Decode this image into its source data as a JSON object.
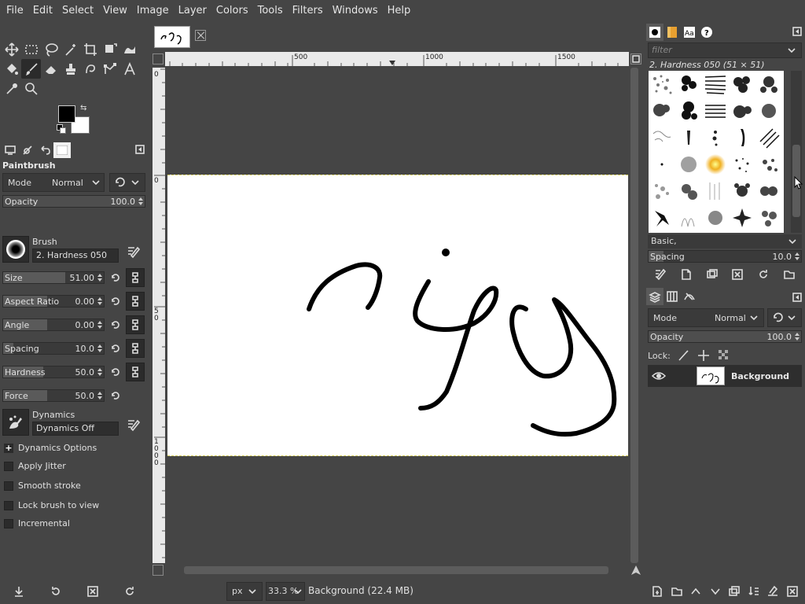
{
  "menubar": {
    "items": [
      "File",
      "Edit",
      "Select",
      "View",
      "Image",
      "Layer",
      "Colors",
      "Tools",
      "Filters",
      "Windows",
      "Help"
    ]
  },
  "tools": {
    "rows": [
      [
        "move-icon",
        "rect-select-icon",
        "lasso-icon",
        "fuzzy-select-icon",
        "crop-icon",
        "unified-transform-icon",
        "warp-icon"
      ],
      [
        "bucket-fill-icon",
        "paintbrush-icon",
        "eraser-icon",
        "clone-icon",
        "smudge-icon",
        "paths-icon",
        "text-icon"
      ],
      [
        "color-picker-icon",
        "zoom-icon"
      ]
    ],
    "active": "paintbrush-icon"
  },
  "colors": {
    "foreground": "#000000",
    "background": "#ffffff"
  },
  "tool_options": {
    "title": "Paintbrush",
    "mode_label": "Mode",
    "mode_value": "Normal",
    "opacity_label": "Opacity",
    "opacity_value": "100.0",
    "brush_label": "Brush",
    "brush_value": "2. Hardness 050",
    "size_label": "Size",
    "size_value": "51.00",
    "aspect_label": "Aspect Ratio",
    "aspect_value": "0.00",
    "angle_label": "Angle",
    "angle_value": "0.00",
    "spacing_label": "Spacing",
    "spacing_value": "10.0",
    "hardness_label": "Hardness",
    "hardness_value": "50.0",
    "force_label": "Force",
    "force_value": "50.0",
    "dynamics_label": "Dynamics",
    "dynamics_value": "Dynamics Off",
    "dynamics_options": "Dynamics Options",
    "apply_jitter": "Apply Jitter",
    "smooth_stroke": "Smooth stroke",
    "lock_brush": "Lock brush to view",
    "incremental": "Incremental"
  },
  "canvas": {
    "hruler_labels": [
      "500",
      "1000",
      "1500"
    ],
    "vruler_labels": [
      "0",
      "0",
      "5 0",
      "1 0 0 0"
    ],
    "unit": "px",
    "zoom": "33.3 %",
    "status": "Background (22.4 MB)"
  },
  "brushes_panel": {
    "filter_placeholder": "filter",
    "brush_name": "2. Hardness 050 (51 × 51)",
    "tag_value": "Basic,",
    "spacing_label": "Spacing",
    "spacing_value": "10.0"
  },
  "layers_panel": {
    "mode_label": "Mode",
    "mode_value": "Normal",
    "opacity_label": "Opacity",
    "opacity_value": "100.0",
    "lock_label": "Lock:",
    "layer_name": "Background"
  }
}
